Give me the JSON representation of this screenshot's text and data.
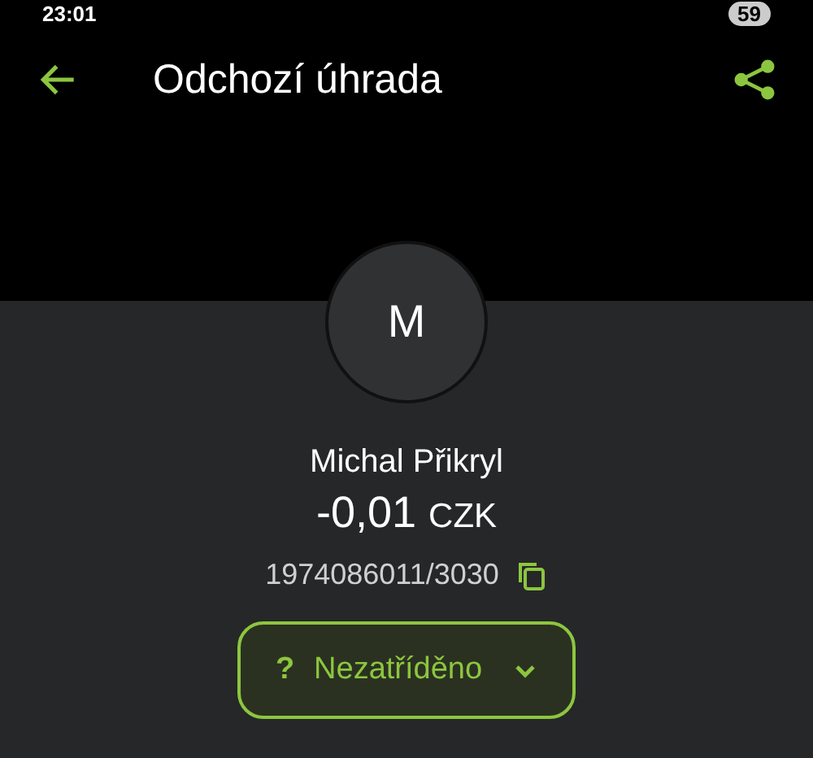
{
  "status_bar": {
    "time": "23:01",
    "battery": "59"
  },
  "app_bar": {
    "title": "Odchozí úhrada"
  },
  "avatar": {
    "initial": "M"
  },
  "payment": {
    "name": "Michal Přikryl",
    "amount": "-0,01",
    "currency": "CZK",
    "account": "1974086011/3030"
  },
  "category_button": {
    "icon": "?",
    "label": "Nezatříděno"
  }
}
